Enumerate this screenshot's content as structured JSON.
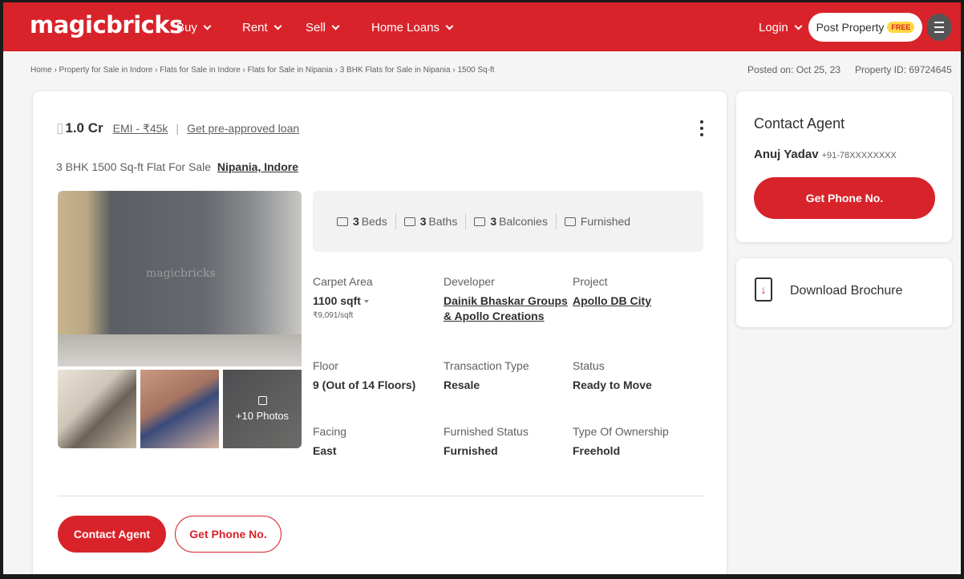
{
  "header": {
    "logo": "magicbricks",
    "nav": [
      "Buy",
      "Rent",
      "Sell",
      "Home Loans"
    ],
    "login": "Login",
    "post_property": "Post Property",
    "free_badge": "FREE"
  },
  "breadcrumb": "Home › Property for Sale in Indore › Flats for Sale in Indore › Flats for Sale in Nipania › 3 BHK Flats for Sale in Nipania › 1500 Sq-ft",
  "meta": {
    "posted": "Posted on: Oct 25, 23",
    "property_id": "Property ID: 69724645"
  },
  "listing": {
    "price": "1.0 Cr",
    "emi": "EMI - ₹45k",
    "preapproved": "Get pre-approved loan",
    "subtitle": "3 BHK 1500 Sq-ft Flat For Sale",
    "location": "Nipania, Indore",
    "photo_watermark": "magicbricks",
    "more_photos": "+10 Photos",
    "specs": {
      "beds_num": "3",
      "beds_label": "Beds",
      "baths_num": "3",
      "baths_label": "Baths",
      "balc_num": "3",
      "balc_label": "Balconies",
      "furnished": "Furnished"
    },
    "details": {
      "carpet_label": "Carpet Area",
      "carpet_value": "1100 sqft",
      "carpet_rate": "₹9,091/sqft",
      "developer_label": "Developer",
      "developer_value_1": "Dainik Bhaskar Groups",
      "developer_value_2": "& Apollo Creations",
      "project_label": "Project",
      "project_value": "Apollo DB City",
      "floor_label": "Floor",
      "floor_value": "9 (Out of 14 Floors)",
      "transaction_label": "Transaction Type",
      "transaction_value": "Resale",
      "status_label": "Status",
      "status_value": "Ready to Move",
      "facing_label": "Facing",
      "facing_value": "East",
      "furnished_label": "Furnished Status",
      "furnished_value": "Furnished",
      "ownership_label": "Type Of Ownership",
      "ownership_value": "Freehold"
    },
    "btn_contact": "Contact Agent",
    "btn_phone": "Get Phone No."
  },
  "sidebar": {
    "title": "Contact Agent",
    "agent_name": "Anuj Yadav",
    "agent_phone": "+91-78XXXXXXXX",
    "btn_phone": "Get Phone No.",
    "brochure": "Download Brochure"
  },
  "colors": {
    "brand": "#d8232a",
    "free": "#ffd740"
  }
}
